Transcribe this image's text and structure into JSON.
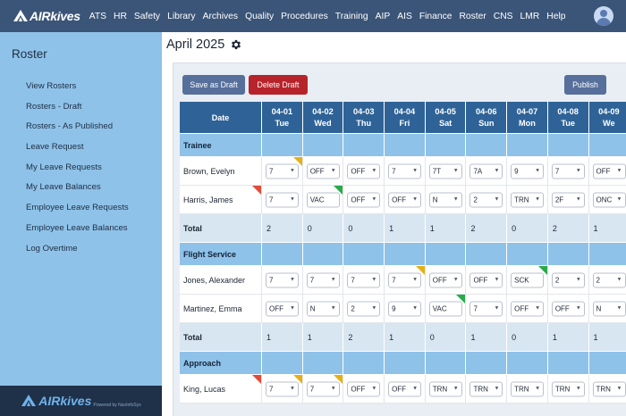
{
  "app": {
    "logo_text": "AIRkives"
  },
  "nav": {
    "items": [
      "ATS",
      "HR",
      "Safety",
      "Library",
      "Archives",
      "Quality",
      "Procedures",
      "Training",
      "AIP",
      "AIS",
      "Finance",
      "Roster",
      "CNS",
      "LMR",
      "Help"
    ]
  },
  "sidebar": {
    "title": "Roster",
    "items": [
      "View Rosters",
      "Rosters - Draft",
      "Rosters - As Published",
      "Leave Request",
      "My Leave Requests",
      "My Leave Balances",
      "Employee Leave Requests",
      "Employee Leave Balances",
      "Log Overtime"
    ],
    "footer_logo": "AIRkives",
    "footer_sub": "Powered by NavInfoSys"
  },
  "page": {
    "title": "April 2025"
  },
  "toolbar": {
    "save_draft": "Save as Draft",
    "delete_draft": "Delete Draft",
    "publish": "Publish"
  },
  "table": {
    "date_header": "Date",
    "days": [
      {
        "date": "04-01",
        "dow": "Tue"
      },
      {
        "date": "04-02",
        "dow": "Wed"
      },
      {
        "date": "04-03",
        "dow": "Thu"
      },
      {
        "date": "04-04",
        "dow": "Fri"
      },
      {
        "date": "04-05",
        "dow": "Sat"
      },
      {
        "date": "04-06",
        "dow": "Sun"
      },
      {
        "date": "04-07",
        "dow": "Mon"
      },
      {
        "date": "04-08",
        "dow": "Tue"
      },
      {
        "date": "04-09",
        "dow": "We"
      }
    ],
    "total_label": "Total",
    "groups": [
      {
        "name": "Trainee",
        "people": [
          {
            "name": "Brown, Evelyn",
            "name_flag": "",
            "cells": [
              {
                "v": "7",
                "flag": "orange"
              },
              {
                "v": "OFF",
                "flag": ""
              },
              {
                "v": "OFF",
                "flag": ""
              },
              {
                "v": "7",
                "flag": ""
              },
              {
                "v": "7T",
                "flag": ""
              },
              {
                "v": "7A",
                "flag": ""
              },
              {
                "v": "9",
                "flag": ""
              },
              {
                "v": "7",
                "flag": ""
              },
              {
                "v": "OFF",
                "flag": ""
              }
            ]
          },
          {
            "name": "Harris, James",
            "name_flag": "red",
            "cells": [
              {
                "v": "7",
                "flag": ""
              },
              {
                "v": "VAC",
                "flag": "green",
                "plain": true
              },
              {
                "v": "OFF",
                "flag": ""
              },
              {
                "v": "OFF",
                "flag": ""
              },
              {
                "v": "N",
                "flag": ""
              },
              {
                "v": "2",
                "flag": ""
              },
              {
                "v": "TRN",
                "flag": ""
              },
              {
                "v": "2F",
                "flag": ""
              },
              {
                "v": "ONC",
                "flag": ""
              }
            ]
          }
        ],
        "totals": [
          "2",
          "0",
          "0",
          "1",
          "1",
          "2",
          "0",
          "2",
          "1"
        ]
      },
      {
        "name": "Flight Service",
        "people": [
          {
            "name": "Jones, Alexander",
            "name_flag": "",
            "cells": [
              {
                "v": "7",
                "flag": ""
              },
              {
                "v": "7",
                "flag": ""
              },
              {
                "v": "7",
                "flag": ""
              },
              {
                "v": "7",
                "flag": "orange"
              },
              {
                "v": "OFF",
                "flag": ""
              },
              {
                "v": "OFF",
                "flag": ""
              },
              {
                "v": "SCK",
                "flag": "green",
                "plain": true
              },
              {
                "v": "2",
                "flag": ""
              },
              {
                "v": "2",
                "flag": ""
              }
            ]
          },
          {
            "name": "Martinez, Emma",
            "name_flag": "",
            "cells": [
              {
                "v": "OFF",
                "flag": ""
              },
              {
                "v": "N",
                "flag": ""
              },
              {
                "v": "2",
                "flag": ""
              },
              {
                "v": "9",
                "flag": ""
              },
              {
                "v": "VAC",
                "flag": "green",
                "plain": true
              },
              {
                "v": "7",
                "flag": ""
              },
              {
                "v": "OFF",
                "flag": ""
              },
              {
                "v": "OFF",
                "flag": ""
              },
              {
                "v": "N",
                "flag": ""
              }
            ]
          }
        ],
        "totals": [
          "1",
          "1",
          "2",
          "1",
          "0",
          "1",
          "0",
          "1",
          "1"
        ]
      },
      {
        "name": "Approach",
        "people": [
          {
            "name": "King, Lucas",
            "name_flag": "red",
            "cells": [
              {
                "v": "7",
                "flag": "orange"
              },
              {
                "v": "7",
                "flag": "orange"
              },
              {
                "v": "OFF",
                "flag": ""
              },
              {
                "v": "OFF",
                "flag": ""
              },
              {
                "v": "TRN",
                "flag": ""
              },
              {
                "v": "TRN",
                "flag": ""
              },
              {
                "v": "TRN",
                "flag": ""
              },
              {
                "v": "TRN",
                "flag": ""
              },
              {
                "v": "TRN",
                "flag": ""
              }
            ]
          }
        ],
        "totals": []
      }
    ]
  },
  "colors": {
    "nav_bg": "#3b5578",
    "sidebar_bg": "#8fc2e8",
    "header_bg": "#2f6397",
    "flag_orange": "#e6b015",
    "flag_green": "#2aaa4a",
    "flag_red": "#e24b3b",
    "delete_btn": "#b7232a"
  },
  "icons": {
    "gear": "gear-icon",
    "user": "user-icon"
  }
}
